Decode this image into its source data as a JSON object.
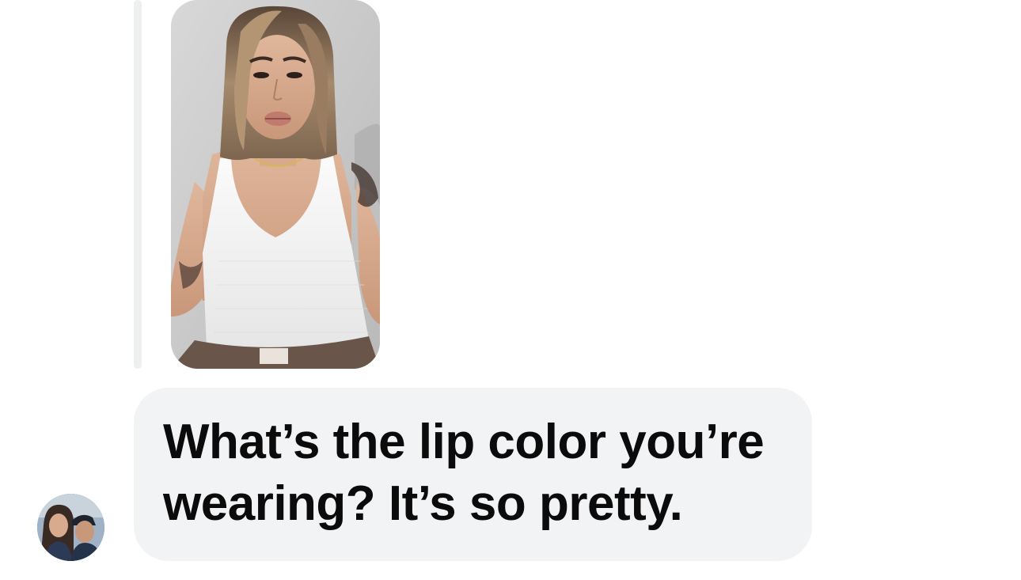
{
  "thread": {
    "shared_media": {
      "kind": "video-thumbnail",
      "icon": "shared-photo"
    },
    "message": {
      "text": "What’s the lip color you’re wearing? It’s so pretty."
    },
    "sender": {
      "avatar_icon": "avatar-photo"
    }
  },
  "colors": {
    "bubble_background": "#f2f3f5",
    "reply_bar": "#eeeff1",
    "text": "#0b0b0c",
    "page_background": "#ffffff"
  }
}
